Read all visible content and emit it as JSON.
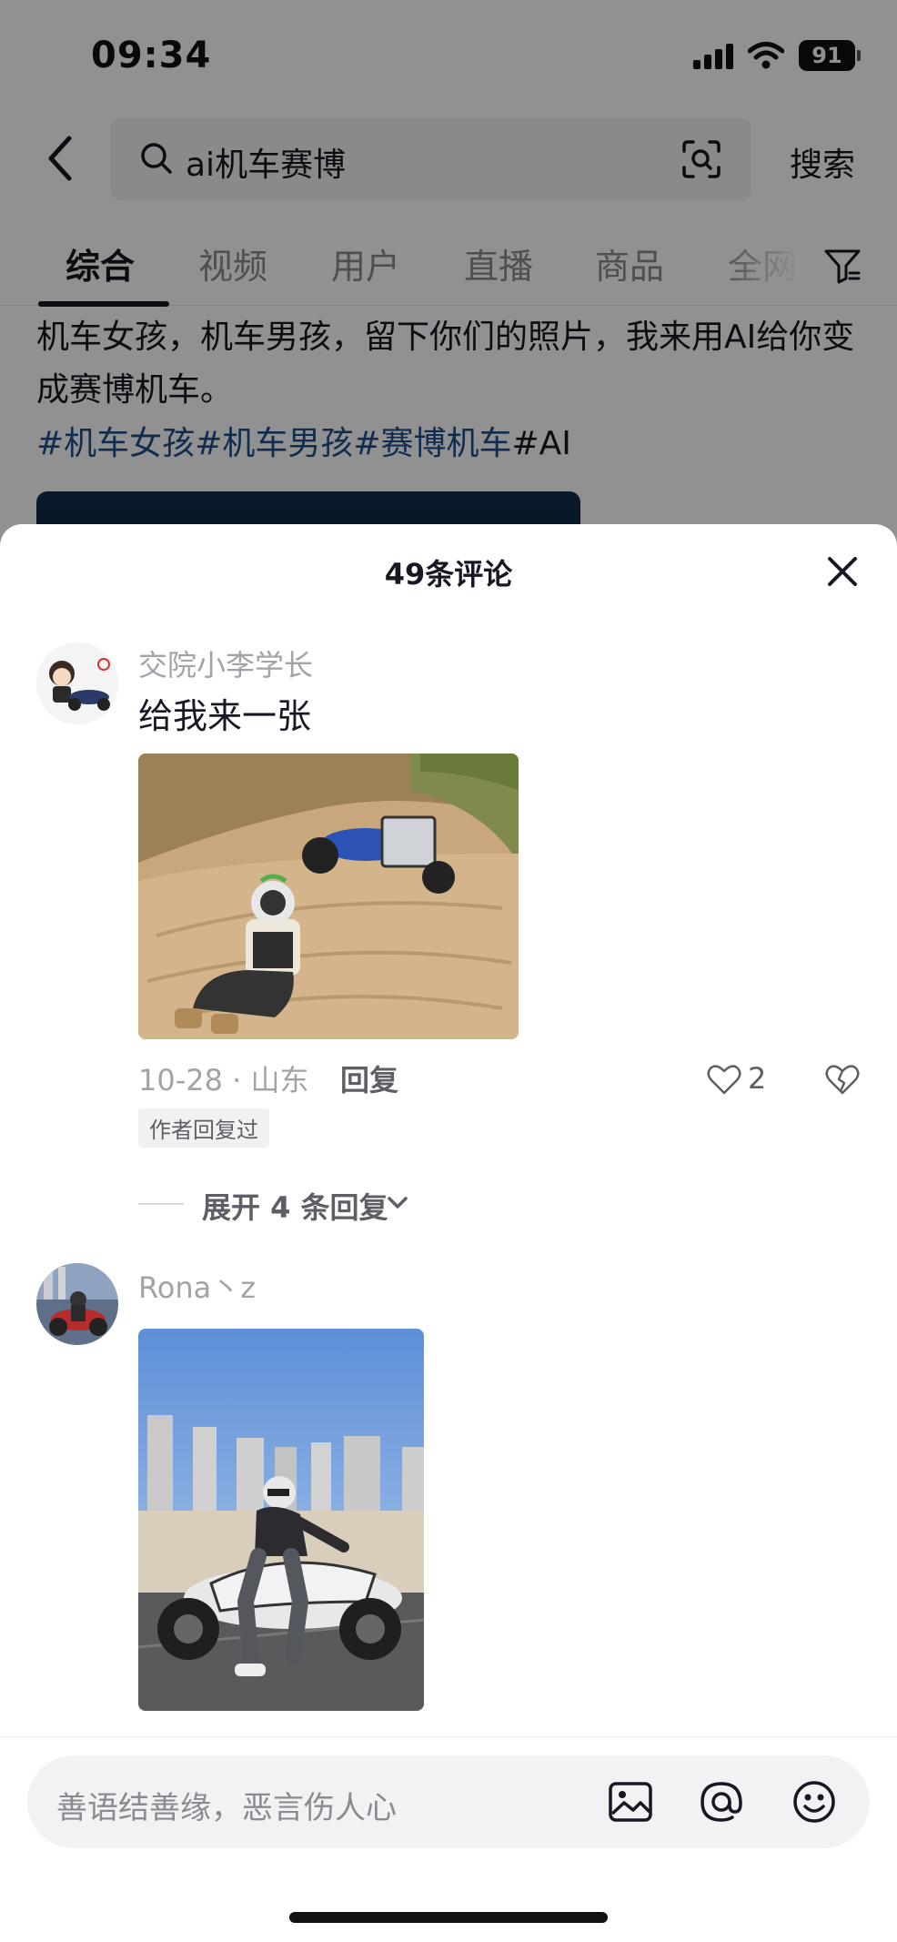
{
  "status_bar": {
    "time": "09:34",
    "battery": "91"
  },
  "search": {
    "query": "ai机车赛博",
    "search_label": "搜索"
  },
  "tabs": [
    {
      "label": "综合",
      "active": true
    },
    {
      "label": "视频",
      "active": false
    },
    {
      "label": "用户",
      "active": false
    },
    {
      "label": "直播",
      "active": false
    },
    {
      "label": "商品",
      "active": false
    },
    {
      "label": "全网",
      "active": false
    }
  ],
  "post": {
    "text": "机车女孩，机车男孩，留下你们的照片，我来用AI给你变成赛博机车。",
    "hashtags": "#机车女孩#机车男孩#赛博机车",
    "hashtag_tail": "#AI"
  },
  "sheet": {
    "title": "49条评论"
  },
  "comments": [
    {
      "name": "交院小李学长",
      "text": "给我来一张",
      "date_location": "10-28 · 山东",
      "reply_label": "回复",
      "likes": "2",
      "badge": "作者回复过",
      "expand_label": "展开 4 条回复"
    },
    {
      "name": "Rona丶z"
    }
  ],
  "input": {
    "placeholder": "善语结善缘，恶言伤人心"
  },
  "colors": {
    "hashtag": "#1f4e8c",
    "text_primary": "#161823",
    "text_secondary": "#a2a3a8"
  }
}
